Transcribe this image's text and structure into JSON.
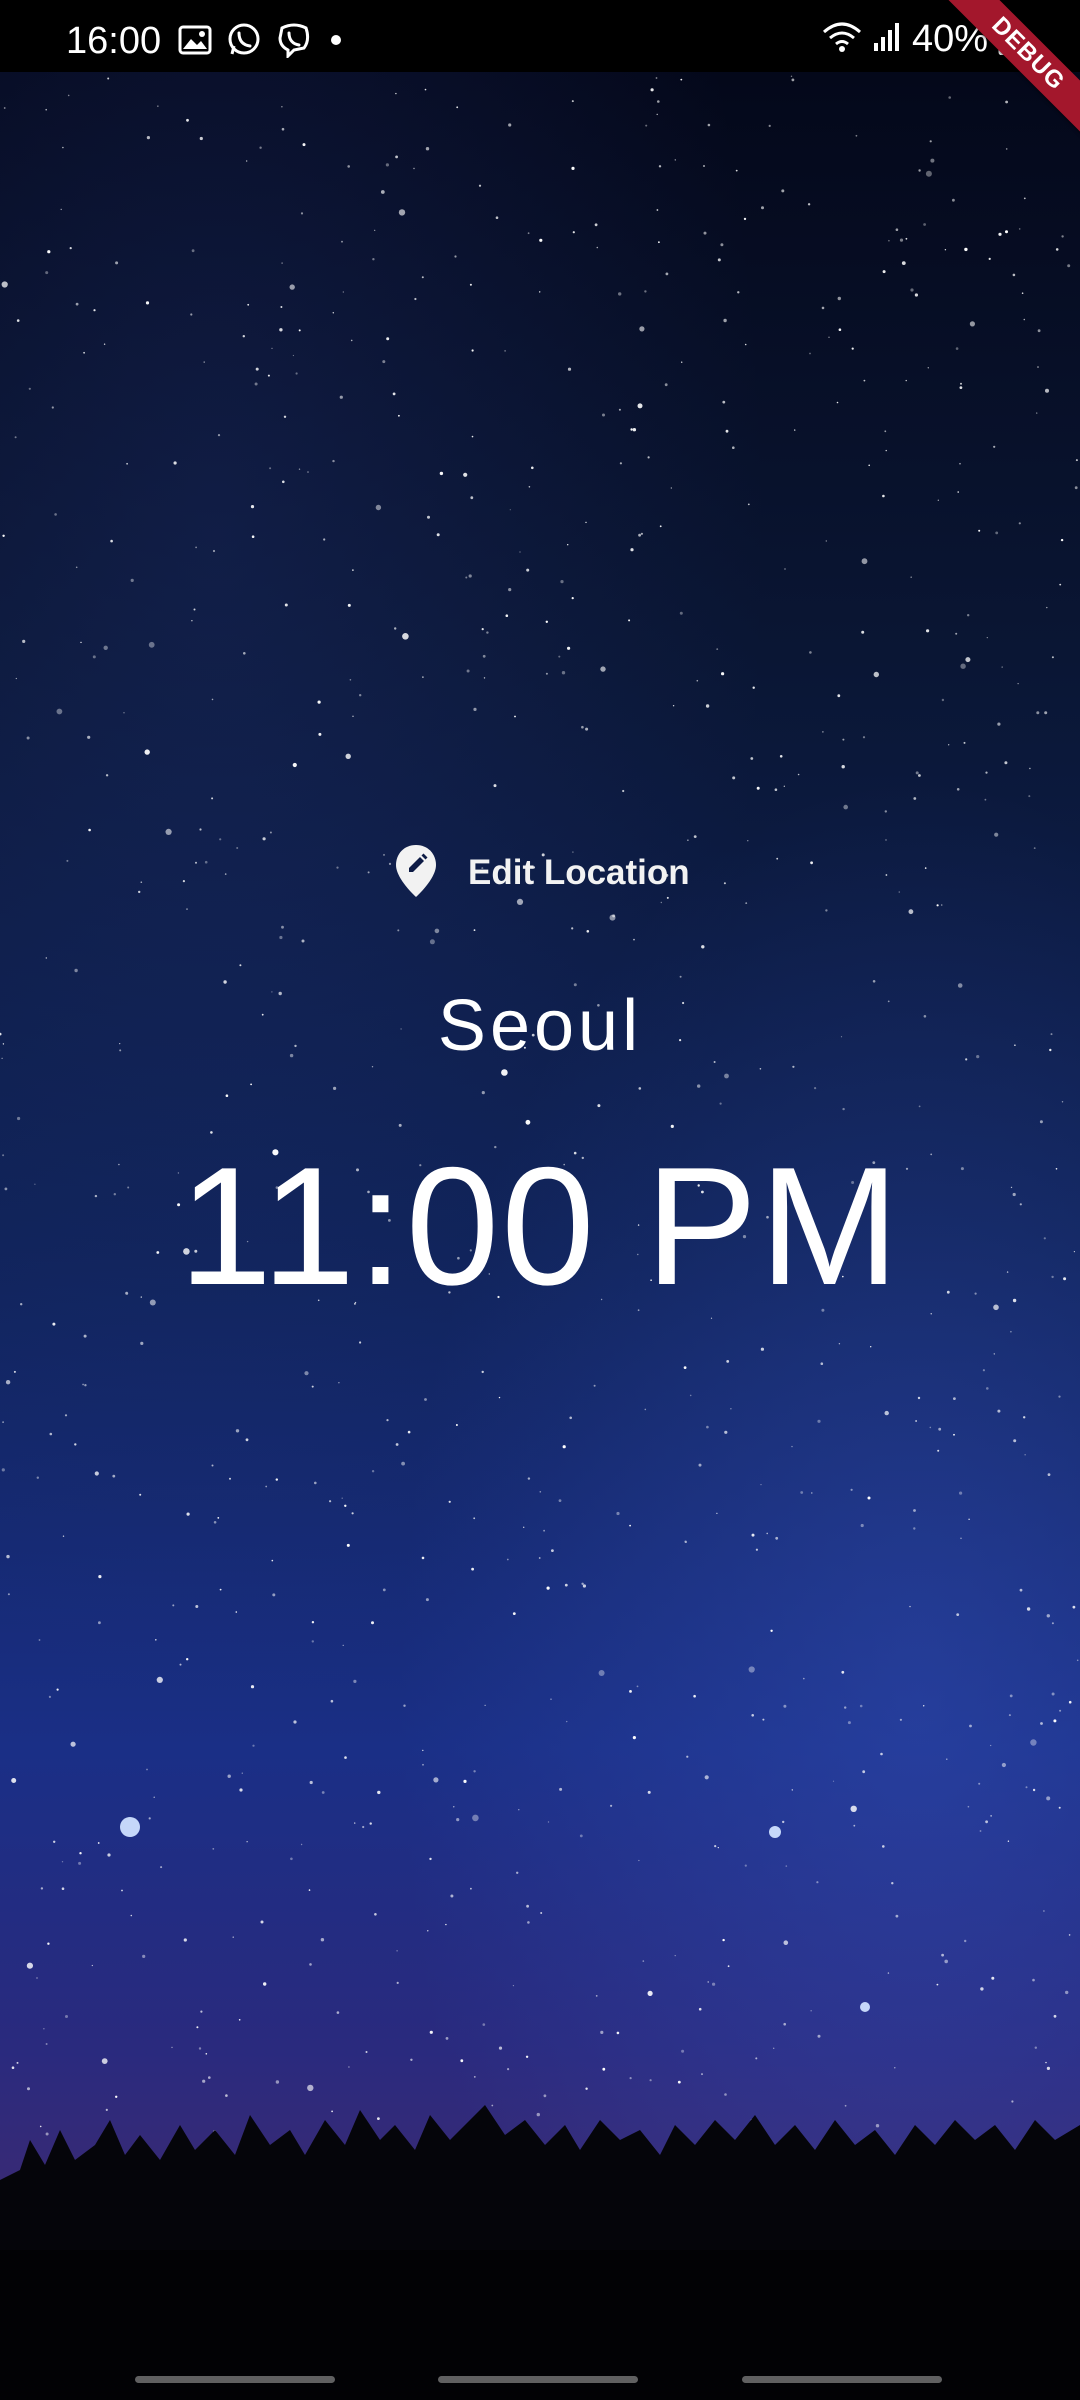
{
  "status_bar": {
    "time": "16:00",
    "left_icons": [
      "gallery-icon",
      "whatsapp-icon",
      "viber-icon",
      "dot-icon"
    ],
    "right_icons": [
      "wifi-icon",
      "signal-icon",
      "battery-icon"
    ],
    "battery": "40%"
  },
  "debug_banner": "DEBUG",
  "edit_location": {
    "label": "Edit Location",
    "icon": "edit-location-icon"
  },
  "location": {
    "city": "Seoul",
    "time": "11:00 PM"
  },
  "background": {
    "scene": "night sky with trees",
    "colors": [
      "#04081a",
      "#0f2257",
      "#1a2f86",
      "#3b2a74"
    ]
  },
  "nav_bar": {
    "handles": 3
  }
}
